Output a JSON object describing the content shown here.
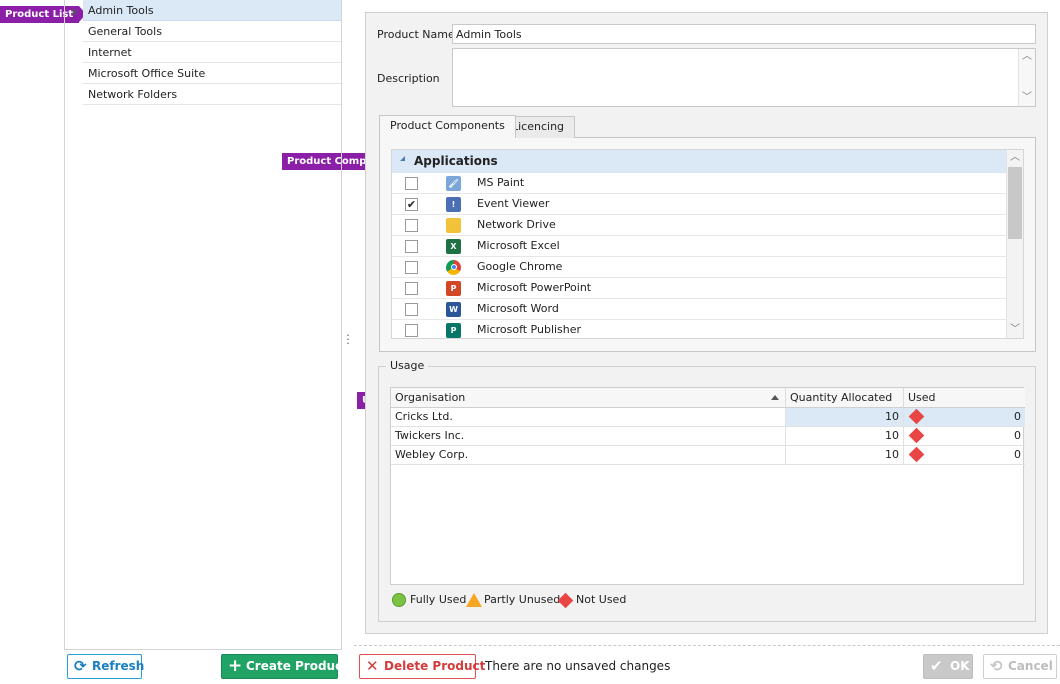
{
  "callouts": {
    "product_list": "Product List",
    "product_components": "Product Components",
    "usage": "Usage"
  },
  "product_list": {
    "items": [
      "Admin Tools",
      "General Tools",
      "Internet",
      "Microsoft Office Suite",
      "Network Folders"
    ],
    "selected": "Admin Tools"
  },
  "form": {
    "product_name_label": "Product Name",
    "product_name_value": "Admin Tools",
    "description_label": "Description",
    "description_value": ""
  },
  "tabs": [
    {
      "label": "Product Components",
      "active": true
    },
    {
      "label": "Licencing",
      "active": false
    }
  ],
  "components": {
    "group": "Applications",
    "items": [
      {
        "name": "MS Paint",
        "checked": false,
        "icon": "paint-icon",
        "color": "#7aa6d8"
      },
      {
        "name": "Event Viewer",
        "checked": true,
        "icon": "event-viewer-icon",
        "color": "#4a6fb5"
      },
      {
        "name": "Network Drive",
        "checked": false,
        "icon": "folder-icon",
        "color": "#f2c23a"
      },
      {
        "name": "Microsoft Excel",
        "checked": false,
        "icon": "excel-icon",
        "color": "#1e7145"
      },
      {
        "name": "Google Chrome",
        "checked": false,
        "icon": "chrome-icon",
        "color": "#db4437"
      },
      {
        "name": "Microsoft PowerPoint",
        "checked": false,
        "icon": "powerpoint-icon",
        "color": "#d24726"
      },
      {
        "name": "Microsoft Word",
        "checked": false,
        "icon": "word-icon",
        "color": "#2b579a"
      },
      {
        "name": "Microsoft Publisher",
        "checked": false,
        "icon": "publisher-icon",
        "color": "#077568"
      }
    ]
  },
  "usage": {
    "title": "Usage",
    "columns": [
      "Organisation",
      "Quantity Allocated",
      "Used"
    ],
    "rows": [
      {
        "organisation": "Cricks Ltd.",
        "quantity": "10",
        "used": "0",
        "status": "Not Used"
      },
      {
        "organisation": "Twickers Inc.",
        "quantity": "10",
        "used": "0",
        "status": "Not Used"
      },
      {
        "organisation": "Webley Corp.",
        "quantity": "10",
        "used": "0",
        "status": "Not Used"
      }
    ],
    "legend": {
      "fully_used": "Fully Used",
      "partly_unused": "Partly Unused",
      "not_used": "Not Used"
    },
    "status_colors": {
      "fully_used": "#7cc243",
      "partly_unused": "#f5a623",
      "not_used": "#e94545"
    }
  },
  "buttons": {
    "refresh": "Refresh",
    "create_product": "Create Product",
    "delete_product": "Delete Product",
    "ok": "OK",
    "cancel": "Cancel"
  },
  "status_text": "There are no unsaved changes"
}
